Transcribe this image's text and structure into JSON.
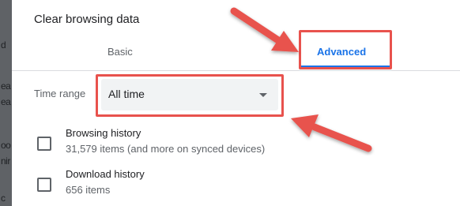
{
  "background": {
    "fragments": [
      "d",
      "ea",
      "ea",
      "oo",
      "nir",
      "c"
    ]
  },
  "dialog": {
    "title": "Clear browsing data",
    "tabs": [
      {
        "label": "Basic",
        "selected": false
      },
      {
        "label": "Advanced",
        "selected": true
      }
    ],
    "time_range": {
      "label": "Time range",
      "value": "All time"
    },
    "items": [
      {
        "title": "Browsing history",
        "detail": "31,579 items (and more on synced devices)",
        "checked": false
      },
      {
        "title": "Download history",
        "detail": "656 items",
        "checked": false
      }
    ]
  },
  "colors": {
    "accent": "#1a73e8",
    "annotation": "#e8524d"
  }
}
